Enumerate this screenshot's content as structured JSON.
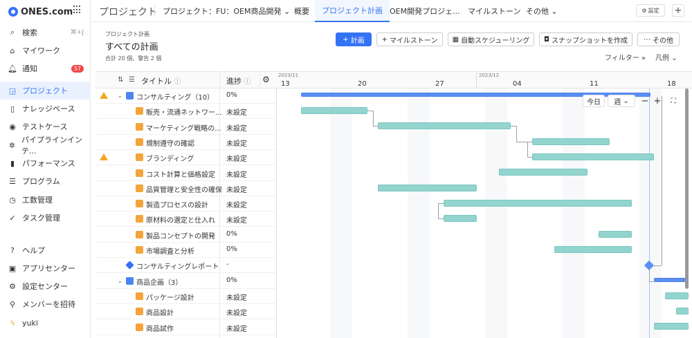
{
  "app": {
    "logo_text": "ONES.com"
  },
  "sidebar": {
    "items": [
      {
        "label": "検索",
        "icon": "search-icon",
        "kbd": "⌘+J"
      },
      {
        "label": "マイワーク",
        "icon": "home-icon"
      },
      {
        "label": "通知",
        "icon": "bell-icon",
        "badge": "57"
      },
      {
        "label": "プロジェクト",
        "icon": "project-icon"
      },
      {
        "label": "ナレッジベース",
        "icon": "document-icon"
      },
      {
        "label": "テストケース",
        "icon": "testcase-icon"
      },
      {
        "label": "パイプラインインテ...",
        "icon": "pipeline-icon"
      },
      {
        "label": "パフォーマンス",
        "icon": "chart-icon"
      },
      {
        "label": "プログラム",
        "icon": "program-icon"
      },
      {
        "label": "工数管理",
        "icon": "clock-icon"
      },
      {
        "label": "タスク管理",
        "icon": "task-icon"
      }
    ],
    "bottom_items": [
      {
        "label": "ヘルプ",
        "icon": "help-icon"
      },
      {
        "label": "アプリセンター",
        "icon": "app-icon"
      },
      {
        "label": "設定センター",
        "icon": "gear-icon"
      },
      {
        "label": "メンバーを招待",
        "icon": "invite-icon"
      },
      {
        "label": "yuki",
        "icon": "user-icon"
      }
    ]
  },
  "topbar": {
    "title": "プロジェクト",
    "project_select": "プロジェクト：FU：OEM商品開発",
    "tabs": [
      {
        "label": "概要"
      },
      {
        "label": "プロジェクト計画"
      },
      {
        "label": "OEM開発プロジェ..."
      },
      {
        "label": "マイルストーン"
      },
      {
        "label": "その他"
      }
    ],
    "settings_label": "設定"
  },
  "header": {
    "breadcrumb": "プロジェクト計画",
    "title": "すべての計画",
    "summary": "合計 20 個、警告 2 個",
    "buttons": {
      "plan": "計画",
      "milestone": "マイルストーン",
      "auto_schedule": "自動スケジューリング",
      "snapshot": "スナップショットを作成",
      "more": "その他"
    },
    "filter_label": "フィルター",
    "legend_label": "凡例"
  },
  "tree": {
    "col_title": "タイトル",
    "col_progress": "進捗",
    "rows": [
      {
        "label": "コンサルティング（10）",
        "progress": "0%",
        "warn": true,
        "caret": true,
        "icon": "blue"
      },
      {
        "label": "販売・流通ネットワー...",
        "progress": "未設定",
        "icon": "orange"
      },
      {
        "label": "マーケティング戦略の...",
        "progress": "未設定",
        "icon": "orange"
      },
      {
        "label": "規制遵守の確認",
        "progress": "未設定",
        "icon": "orange"
      },
      {
        "label": "ブランディング",
        "progress": "未設定",
        "warn": true,
        "icon": "orange"
      },
      {
        "label": "コスト計算と価格設定",
        "progress": "未設定",
        "icon": "orange"
      },
      {
        "label": "品質管理と安全性の確保",
        "progress": "未設定",
        "icon": "orange"
      },
      {
        "label": "製造プロセスの設計",
        "progress": "未設定",
        "icon": "orange"
      },
      {
        "label": "原材料の選定と仕入れ",
        "progress": "未設定",
        "icon": "orange"
      },
      {
        "label": "製品コンセプトの開発",
        "progress": "0%",
        "icon": "orange"
      },
      {
        "label": "市場調査と分析",
        "progress": "0%",
        "icon": "orange"
      },
      {
        "label": "コンサルティングレポート",
        "progress": "-",
        "icon": "diamond"
      },
      {
        "label": "商品企画（3）",
        "progress": "0%",
        "caret": true,
        "icon": "blue"
      },
      {
        "label": "パッケージ設計",
        "progress": "未設定",
        "icon": "orange"
      },
      {
        "label": "商品設計",
        "progress": "未設定",
        "icon": "orange"
      },
      {
        "label": "商品試作",
        "progress": "未設定",
        "icon": "orange"
      }
    ]
  },
  "gantt": {
    "months": [
      "2023/11",
      "2023/12"
    ],
    "days": [
      "13",
      "20",
      "27",
      "04",
      "11",
      "18"
    ],
    "today_label": "今日",
    "scale_label": "週"
  }
}
